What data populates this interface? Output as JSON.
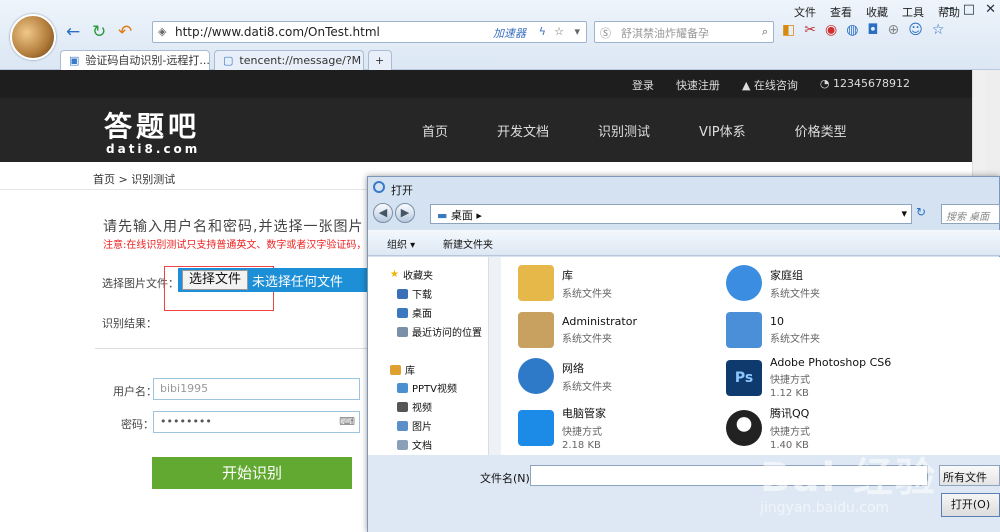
{
  "browser": {
    "menu": [
      "文件",
      "查看",
      "收藏",
      "工具",
      "帮助"
    ],
    "url": "http://www.dati8.com/OnTest.html",
    "accelerator": "加速器",
    "search_placeholder": "舒淇禁油炸耀备孕",
    "tabs": [
      {
        "label": "验证码自动识别-远程打..."
      },
      {
        "label": "tencent://message/?M"
      }
    ]
  },
  "site": {
    "top_links": [
      "登录",
      "快速注册",
      "在线咨询",
      "12345678912"
    ],
    "logo": "答题吧",
    "logo_sub": "dati8.com",
    "nav": [
      "首页",
      "开发文档",
      "识别测试",
      "VIP体系",
      "价格类型"
    ],
    "breadcrumb": "首页 > 识别测试",
    "prompt": "请先输入用户名和密码,并选择一张图片",
    "note": "注意:在线识别测试只支持普通英文、数字或者汉字验证码，远",
    "file_label": "选择图片文件：",
    "file_button": "选择文件",
    "file_status": "未选择任何文件",
    "result_label": "识别结果：",
    "username_label": "用户名：",
    "username_value": "bibi1995",
    "password_label": "密码：",
    "password_value": "••••••••",
    "start_button": "开始识别"
  },
  "dialog": {
    "title": "打开",
    "path": "桌面",
    "search_placeholder": "搜索 桌面",
    "organize": "组织 ▾",
    "new_folder": "新建文件夹",
    "tree": [
      {
        "label": "收藏夹",
        "color": "#f0b400"
      },
      {
        "label": "下载",
        "color": "#3b6fb8"
      },
      {
        "label": "桌面",
        "color": "#3b78c0"
      },
      {
        "label": "最近访问的位置",
        "color": "#7a8fa8"
      },
      {
        "label": "库",
        "color": "#e0a030"
      },
      {
        "label": "PPTV视频",
        "color": "#4a90d0"
      },
      {
        "label": "视频",
        "color": "#555"
      },
      {
        "label": "图片",
        "color": "#5a8fc8"
      },
      {
        "label": "文档",
        "color": "#8aa0b8"
      }
    ],
    "files": [
      {
        "name": "库",
        "type": "系统文件夹",
        "size": "",
        "color": "#e6b84a"
      },
      {
        "name": "家庭组",
        "type": "系统文件夹",
        "size": "",
        "color": "#3a8de0"
      },
      {
        "name": "Administrator",
        "type": "系统文件夹",
        "size": "",
        "color": "#c8a060"
      },
      {
        "name": "10",
        "type": "系统文件夹",
        "size": "",
        "color": "#4a8fd8"
      },
      {
        "name": "网络",
        "type": "系统文件夹",
        "size": "",
        "color": "#2f7ac8"
      },
      {
        "name": "Adobe Photoshop CS6",
        "type": "快捷方式",
        "size": "1.12 KB",
        "color": "#0e3a6e"
      },
      {
        "name": "电脑管家",
        "type": "快捷方式",
        "size": "2.18 KB",
        "color": "#1c8be8"
      },
      {
        "name": "腾讯QQ",
        "type": "快捷方式",
        "size": "1.40 KB",
        "color": "#222"
      }
    ],
    "filename_label": "文件名(N):",
    "filetype": "所有文件",
    "open_button": "打开(O)"
  },
  "watermark": {
    "text": "Bai 经验",
    "url": "jingyan.baidu.com"
  }
}
